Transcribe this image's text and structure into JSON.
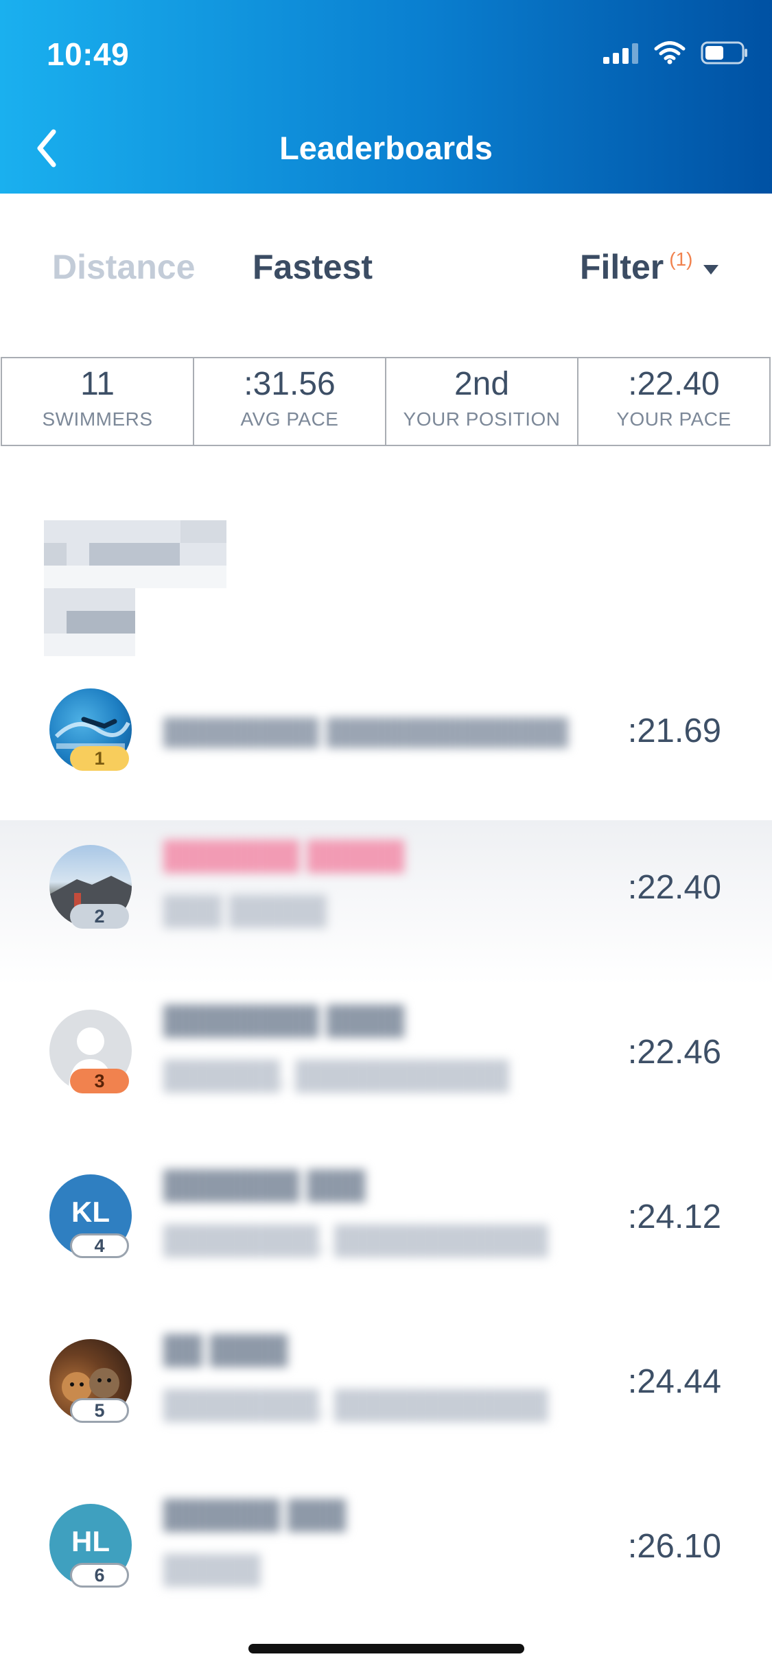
{
  "status_bar": {
    "time": "10:49"
  },
  "header": {
    "title": "Leaderboards"
  },
  "tabs": [
    {
      "label": "Distance"
    },
    {
      "label": "Fastest"
    }
  ],
  "filter": {
    "label": "Filter",
    "count": "(1)"
  },
  "stats": [
    {
      "value": "11",
      "label": "SWIMMERS"
    },
    {
      "value": ":31.56",
      "label": "AVG PACE"
    },
    {
      "value": "2nd",
      "label": "YOUR POSITION"
    },
    {
      "value": ":22.40",
      "label": "YOUR PACE"
    }
  ],
  "colors": {
    "accent": "#0a7fd0",
    "rank1": "#f8cd5c",
    "rank2": "#cbd3dc",
    "rank3": "#f1824e",
    "your_name": "#f29bb4"
  },
  "entries": [
    {
      "rank": "1",
      "pace": ":21.69",
      "avatar": "pool-photo"
    },
    {
      "rank": "2",
      "pace": ":22.40",
      "avatar": "mountain-photo"
    },
    {
      "rank": "3",
      "pace": ":22.46",
      "avatar": "default-person-icon"
    },
    {
      "rank": "4",
      "pace": ":24.12",
      "avatar_initials": "KL"
    },
    {
      "rank": "5",
      "pace": ":24.44",
      "avatar": "cats-photo"
    },
    {
      "rank": "6",
      "pace": ":26.10",
      "avatar_initials": "HL"
    }
  ]
}
